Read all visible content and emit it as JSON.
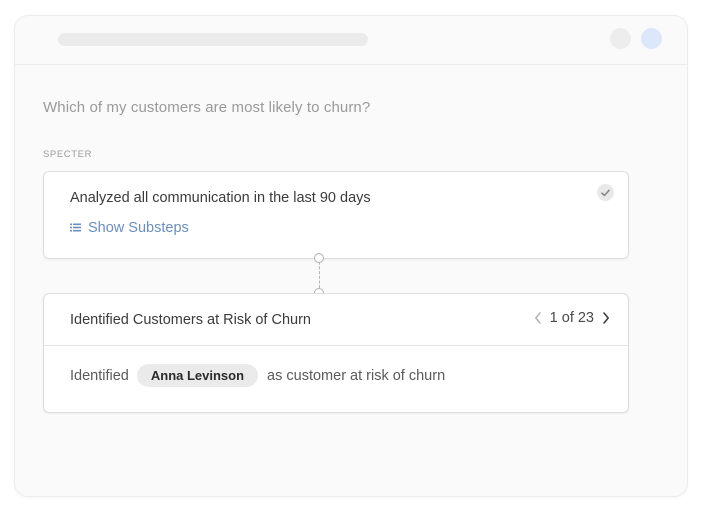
{
  "question": "Which of my customers are most likely to churn?",
  "source_label": "SPECTER",
  "step1": {
    "title": "Analyzed all communication in the last 90 days",
    "substeps_label": "Show Substeps",
    "status_icon": "check-icon"
  },
  "step2": {
    "title": "Identified Customers at Risk of Churn",
    "pager": "1 of 23",
    "result_prefix": "Identified",
    "customer_name": "Anna Levinson",
    "result_suffix": "as customer at risk of churn"
  },
  "colors": {
    "accent_link": "#6a8fbf",
    "avatar_dot": "#dde7fb"
  }
}
